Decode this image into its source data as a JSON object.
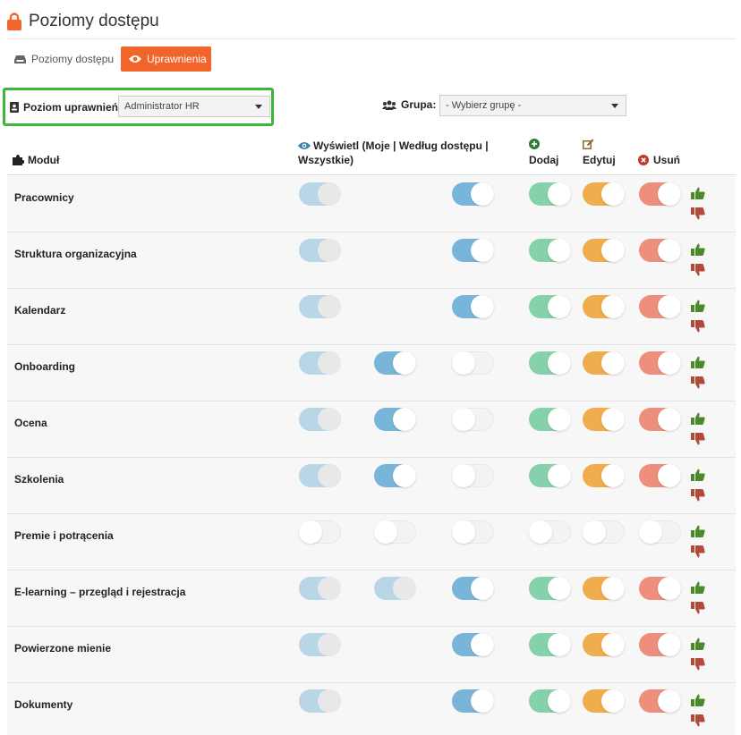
{
  "header": {
    "title": "Poziomy dostępu",
    "icon": "lock-icon",
    "accent": "#f2652a"
  },
  "tabs": [
    {
      "label": "Poziomy dostępu",
      "icon": "inbox-icon",
      "active": false
    },
    {
      "label": "Uprawnienia",
      "icon": "eye-icon",
      "active": true
    }
  ],
  "filters": {
    "level_label": "Poziom uprawnień:",
    "level_value": "Administrator HR",
    "group_label": "Grupa:",
    "group_value": "- Wybierz grupę -"
  },
  "columns": {
    "module": "Moduł",
    "view": "Wyświetl (Moje | Według dostępu | Wszystkie)",
    "add": "Dodaj",
    "edit": "Edytuj",
    "delete": "Usuń"
  },
  "rows": [
    {
      "name": "Pracownicy",
      "toggles": [
        "grey",
        null,
        "blue",
        "green",
        "orange",
        "red"
      ]
    },
    {
      "name": "Struktura organizacyjna",
      "toggles": [
        "grey",
        null,
        "blue",
        "green",
        "orange",
        "red"
      ]
    },
    {
      "name": "Kalendarz",
      "toggles": [
        "grey",
        null,
        "blue",
        "green",
        "orange",
        "red"
      ]
    },
    {
      "name": "Onboarding",
      "toggles": [
        "grey",
        "blue",
        "off",
        "green",
        "orange",
        "red"
      ]
    },
    {
      "name": "Ocena",
      "toggles": [
        "grey",
        "blue",
        "off",
        "green",
        "orange",
        "red"
      ]
    },
    {
      "name": "Szkolenia",
      "toggles": [
        "grey",
        "blue",
        "off",
        "green",
        "orange",
        "red"
      ]
    },
    {
      "name": "Premie i potrącenia",
      "toggles": [
        "off",
        "off",
        "off",
        "off",
        "off",
        "off"
      ]
    },
    {
      "name": "E-learning – przegląd i rejestracja",
      "toggles": [
        "grey",
        "grey",
        "blue",
        "green",
        "orange",
        "red"
      ]
    },
    {
      "name": "Powierzone mienie",
      "toggles": [
        "grey",
        null,
        "blue",
        "green",
        "orange",
        "red"
      ]
    },
    {
      "name": "Dokumenty",
      "toggles": [
        "grey",
        null,
        "blue",
        "green",
        "orange",
        "red"
      ]
    }
  ],
  "colors": {
    "grey_track": "#b9d6e6",
    "blue": "#79b5d8",
    "green": "#84d1ab",
    "orange": "#f0ad4e",
    "red": "#ee8e7d",
    "thumb_up": "#4a8a2a",
    "thumb_down": "#b24a3a",
    "highlight": "#39b83a"
  }
}
